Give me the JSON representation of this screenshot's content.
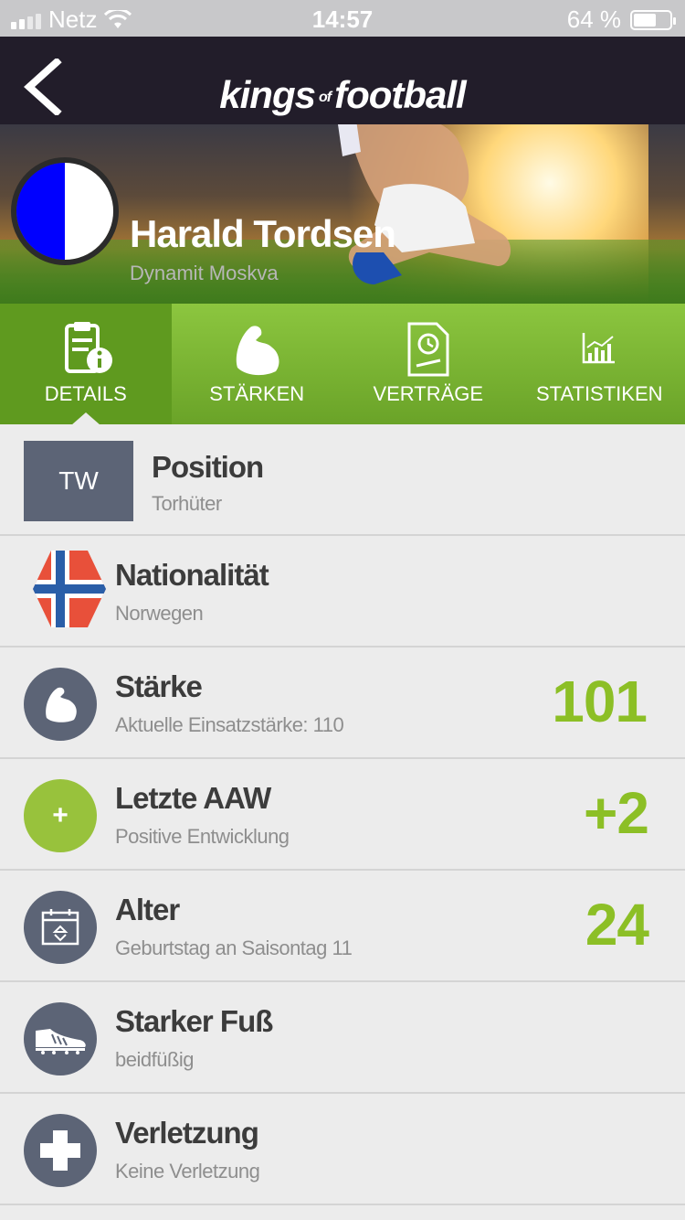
{
  "status_bar": {
    "carrier": "Netz",
    "time": "14:57",
    "battery": "64 %",
    "battery_level": 0.64
  },
  "nav": {
    "logo_left": "kings",
    "logo_of": "of",
    "logo_right": "football"
  },
  "player": {
    "name": "Harald Tordsen",
    "club": "Dynamit Moskva",
    "colors": [
      "#0000ff",
      "#ffffff"
    ]
  },
  "tabs": [
    {
      "label": "DETAILS",
      "icon": "details-icon",
      "active": true
    },
    {
      "label": "STÄRKEN",
      "icon": "strength-icon",
      "active": false
    },
    {
      "label": "VERTRÄGE",
      "icon": "contract-icon",
      "active": false
    },
    {
      "label": "STATISTIKEN",
      "icon": "stats-icon",
      "active": false
    }
  ],
  "details": {
    "position": {
      "badge": "TW",
      "title": "Position",
      "sub": "Torhüter"
    },
    "nationality": {
      "title": "Nationalität",
      "sub": "Norwegen",
      "icon": "norway-flag-icon"
    },
    "strength": {
      "title": "Stärke",
      "sub": "Aktuelle Einsatzstärke: 110",
      "value": "101",
      "icon": "bicep-icon"
    },
    "last_aaw": {
      "title": "Letzte AAW",
      "sub": "Positive Entwicklung",
      "value": "+2",
      "badge": "+"
    },
    "age": {
      "title": "Alter",
      "sub": "Geburtstag an Saisontag 11",
      "value": "24",
      "icon": "calendar-icon"
    },
    "foot": {
      "title": "Starker Fuß",
      "sub": "beidfüßig",
      "icon": "boot-icon"
    },
    "injury": {
      "title": "Verletzung",
      "sub": "Keine Verletzung",
      "icon": "medical-cross-icon"
    }
  },
  "colors": {
    "accent_green": "#8cbf26",
    "tab_green": "#7ab632",
    "nav_dark": "#221d2a",
    "icon_gray": "#5c6476"
  }
}
